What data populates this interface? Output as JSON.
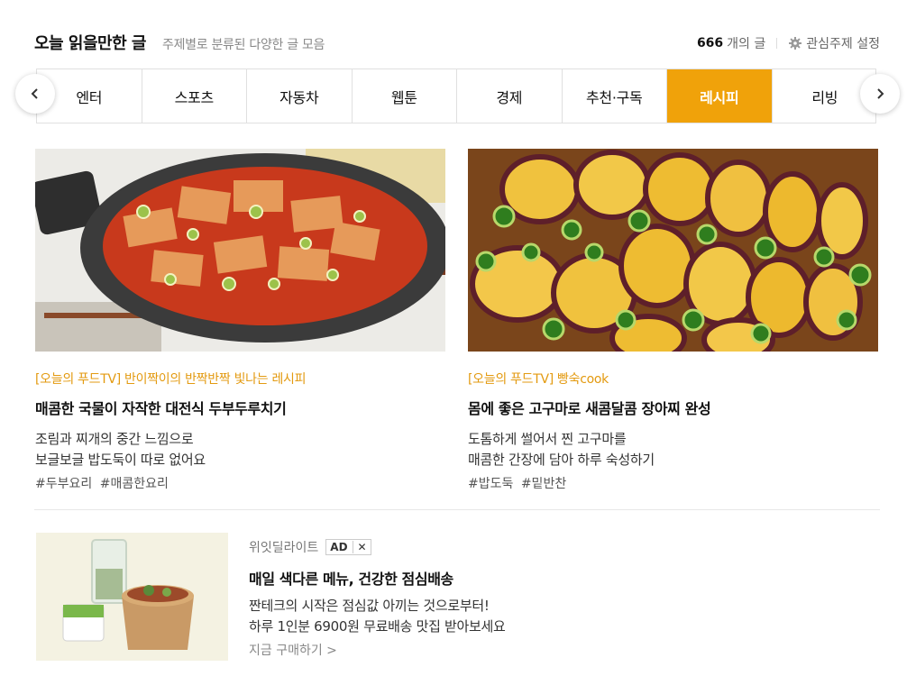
{
  "header": {
    "title": "오늘 읽을만한 글",
    "subtitle": "주제별로 분류된 다양한 글 모음",
    "count": "666",
    "count_suffix": "개의 글",
    "settings_label": "관심주제 설정"
  },
  "tabs": [
    {
      "label": "엔터"
    },
    {
      "label": "스포츠"
    },
    {
      "label": "자동차"
    },
    {
      "label": "웹툰"
    },
    {
      "label": "경제"
    },
    {
      "label": "추천·구독"
    },
    {
      "label": "레시피"
    },
    {
      "label": "리빙"
    }
  ],
  "active_tab": "레시피",
  "colors": {
    "accent": "#f0a20a",
    "source_text": "#e39a10"
  },
  "articles": [
    {
      "source": "[오늘의 푸드TV] 반이짝이의 반짝반짝 빛나는 레시피",
      "headline": "매콤한 국물이 자작한 대전식 두부두루치기",
      "desc_line1": "조림과 찌개의 중간 느낌으로",
      "desc_line2": "보글보글 밥도둑이 따로 없어요",
      "tags": [
        "#두부요리",
        "#매콤한요리"
      ]
    },
    {
      "source": "[오늘의 푸드TV] 빵숙cook",
      "headline": "몸에 좋은 고구마로 새콤달콤 장아찌 완성",
      "desc_line1": "도톰하게 썰어서 찐 고구마를",
      "desc_line2": "매콤한 간장에 담아 하루 숙성하기",
      "tags": [
        "#밥도둑",
        "#밑반찬"
      ]
    }
  ],
  "ad": {
    "advertiser": "위잇딜라이트",
    "badge": "AD",
    "close": "✕",
    "title": "매일 색다른 메뉴, 건강한 점심배송",
    "desc_line1": "짠테크의 시작은 점심값 아끼는 것으로부터!",
    "desc_line2": "하루 1인분 6900원 무료배송 맛집 받아보세요",
    "cta": "지금 구매하기 >"
  }
}
